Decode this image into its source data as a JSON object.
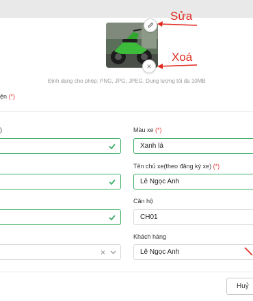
{
  "annotations": {
    "edit": "Sửa",
    "remove": "Xoá"
  },
  "upload": {
    "hint": "Định dạng cho phép: PNG, JPG, JPEG. Dung lượng tối đa 10MB"
  },
  "fields": {
    "power_label": "ện",
    "left1_label": ")",
    "color_label": "Màu xe",
    "color_value": "Xanh lá",
    "owner_label": "Tên chủ xe(theo đăng ký xe)",
    "owner_value": "Lê Ngọc Anh",
    "apartment_label": "Căn hộ",
    "apartment_value": "CH01",
    "customer_label": "Khách hàng",
    "customer_value": "Lê Ngọc Anh",
    "required_mark": "(*)"
  },
  "footer": {
    "cancel_label": "Huỷ"
  },
  "colors": {
    "valid": "#3fb068",
    "required": "#e53935",
    "annotation": "#e0281e"
  }
}
